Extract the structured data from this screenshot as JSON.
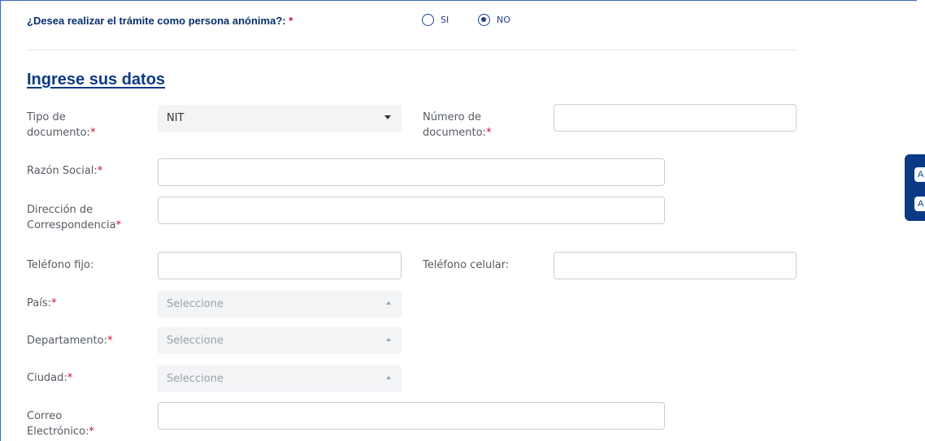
{
  "anon": {
    "question": "¿Desea realizar el trámite como persona anónima?:",
    "required_mark": "*",
    "options": [
      {
        "label": "SI",
        "checked": false
      },
      {
        "label": "NO",
        "checked": true
      }
    ]
  },
  "section": {
    "title": "Ingrese sus datos"
  },
  "form": {
    "tipo_doc": {
      "label_1": "Tipo de",
      "label_2": "documento:",
      "req": "*",
      "value": "NIT"
    },
    "numero_doc": {
      "label_1": "Número de",
      "label_2": "documento:",
      "req": "*",
      "value": ""
    },
    "razon_social": {
      "label": "Razón Social:",
      "req": "*",
      "value": ""
    },
    "direccion": {
      "label_1": "Dirección de",
      "label_2": "Correspondencia",
      "req": "*",
      "value": ""
    },
    "telefono_fijo": {
      "label": "Teléfono fijo:",
      "value": ""
    },
    "telefono_celular": {
      "label": "Teléfono celular:",
      "value": ""
    },
    "pais": {
      "label": "País:",
      "req": "*",
      "placeholder": "Seleccione"
    },
    "departamento": {
      "label": "Departamento:",
      "req": "*",
      "placeholder": "Seleccione"
    },
    "ciudad": {
      "label": "Ciudad:",
      "req": "*",
      "placeholder": "Seleccione"
    },
    "correo": {
      "label_1": "Correo",
      "label_2": "Electrónico:",
      "req": "*",
      "value": ""
    }
  },
  "side_widget": {
    "btn1": "A",
    "btn2": "A"
  },
  "colors": {
    "primary": "#0a3a85",
    "required": "#c8102e",
    "label": "#555b63"
  }
}
